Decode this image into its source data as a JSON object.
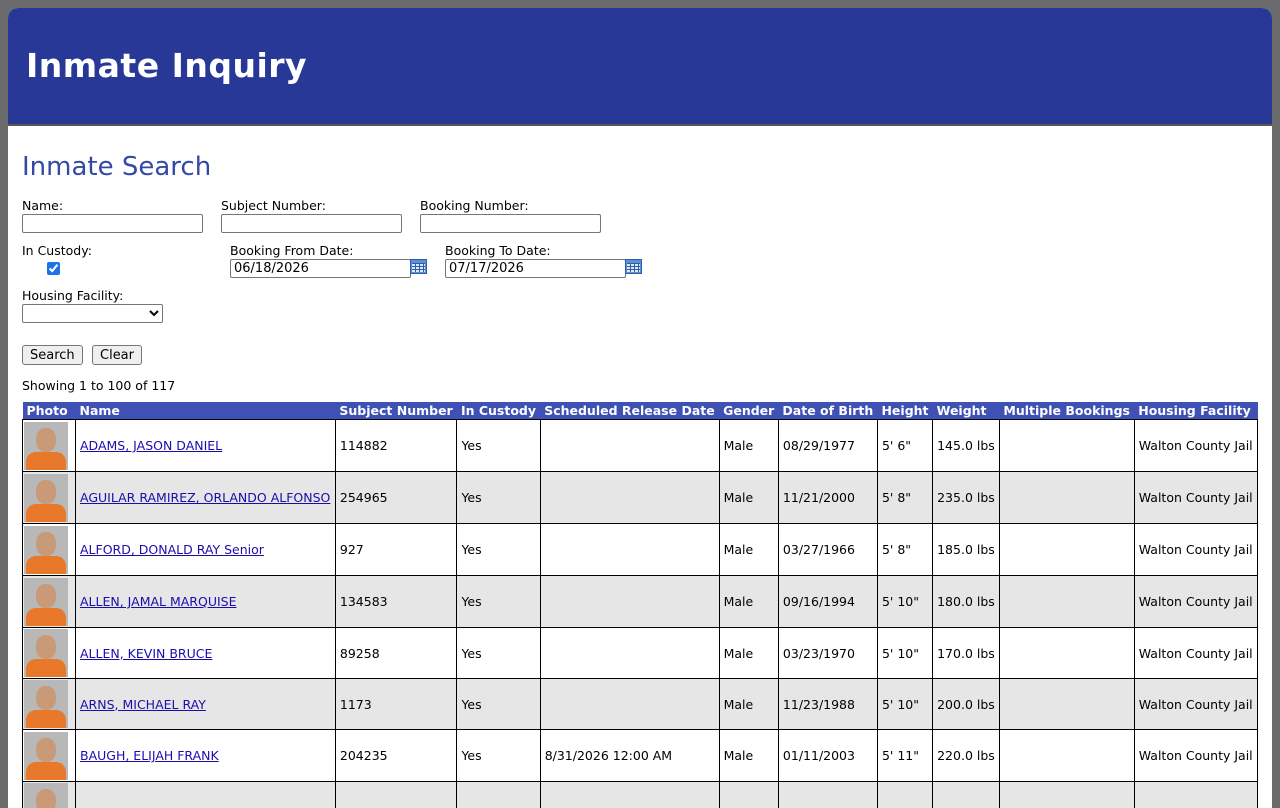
{
  "header": {
    "title": "Inmate Inquiry"
  },
  "search": {
    "title": "Inmate Search",
    "name_label": "Name:",
    "name_value": "",
    "subject_label": "Subject Number:",
    "subject_value": "",
    "booking_label": "Booking Number:",
    "booking_value": "",
    "custody_label": "In Custody:",
    "custody_checked": true,
    "from_label": "Booking From Date:",
    "from_value": "06/18/2026",
    "to_label": "Booking To Date:",
    "to_value": "07/17/2026",
    "facility_label": "Housing Facility:",
    "facility_value": "",
    "search_button": "Search",
    "clear_button": "Clear",
    "calendar_icon": "calendar-icon"
  },
  "results": {
    "showing": "Showing 1 to 100 of 117",
    "columns": [
      "Photo",
      "Name",
      "Subject Number",
      "In Custody",
      "Scheduled Release Date",
      "Gender",
      "Date of Birth",
      "Height",
      "Weight",
      "Multiple Bookings",
      "Housing Facility"
    ],
    "rows": [
      {
        "name": "ADAMS, JASON DANIEL",
        "subject": "114882",
        "custody": "Yes",
        "release": "",
        "gender": "Male",
        "dob": "08/29/1977",
        "height": "5' 6\"",
        "weight": "145.0 lbs",
        "multiple": "",
        "facility": "Walton County Jail"
      },
      {
        "name": "AGUILAR RAMIREZ, ORLANDO ALFONSO",
        "subject": "254965",
        "custody": "Yes",
        "release": "",
        "gender": "Male",
        "dob": "11/21/2000",
        "height": "5' 8\"",
        "weight": "235.0 lbs",
        "multiple": "",
        "facility": "Walton County Jail"
      },
      {
        "name": "ALFORD, DONALD RAY Senior",
        "subject": "927",
        "custody": "Yes",
        "release": "",
        "gender": "Male",
        "dob": "03/27/1966",
        "height": "5' 8\"",
        "weight": "185.0 lbs",
        "multiple": "",
        "facility": "Walton County Jail"
      },
      {
        "name": "ALLEN, JAMAL MARQUISE",
        "subject": "134583",
        "custody": "Yes",
        "release": "",
        "gender": "Male",
        "dob": "09/16/1994",
        "height": "5' 10\"",
        "weight": "180.0 lbs",
        "multiple": "",
        "facility": "Walton County Jail"
      },
      {
        "name": "ALLEN, KEVIN BRUCE",
        "subject": "89258",
        "custody": "Yes",
        "release": "",
        "gender": "Male",
        "dob": "03/23/1970",
        "height": "5' 10\"",
        "weight": "170.0 lbs",
        "multiple": "",
        "facility": "Walton County Jail"
      },
      {
        "name": "ARNS, MICHAEL RAY",
        "subject": "1173",
        "custody": "Yes",
        "release": "",
        "gender": "Male",
        "dob": "11/23/1988",
        "height": "5' 10\"",
        "weight": "200.0 lbs",
        "multiple": "",
        "facility": "Walton County Jail"
      },
      {
        "name": "BAUGH, ELIJAH FRANK",
        "subject": "204235",
        "custody": "Yes",
        "release": "8/31/2026 12:00 AM",
        "gender": "Male",
        "dob": "01/11/2003",
        "height": "5' 11\"",
        "weight": "220.0 lbs",
        "multiple": "",
        "facility": "Walton County Jail"
      },
      {
        "name": "",
        "subject": "",
        "custody": "",
        "release": "",
        "gender": "",
        "dob": "",
        "height": "",
        "weight": "",
        "multiple": "",
        "facility": ""
      }
    ]
  },
  "colors": {
    "header_bg": "#283897",
    "title_blue": "#3449a5",
    "table_header": "#3f51b5",
    "row_alt": "#e6e6e6",
    "link": "#1a0dab"
  }
}
